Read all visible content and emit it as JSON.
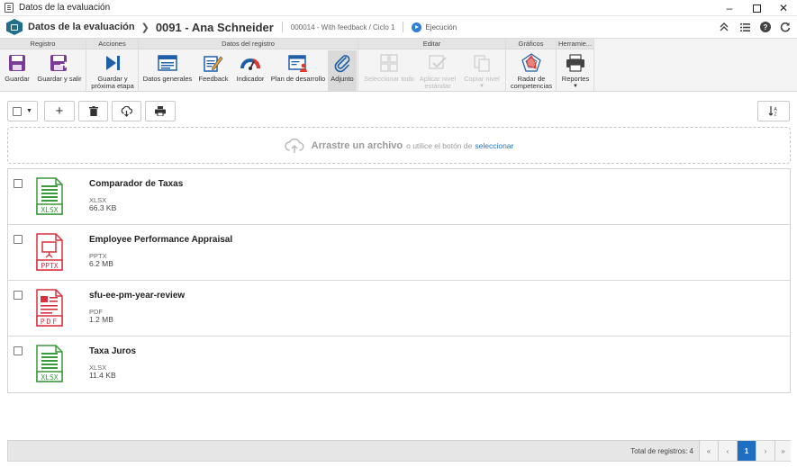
{
  "window": {
    "title": "Datos de la evaluación"
  },
  "header": {
    "section": "Datos de la evaluación",
    "record_title": "0091 - Ana Schneider",
    "subtitle": "000014 - With feedback / Ciclo 1",
    "status": "Ejecución"
  },
  "ribbon": {
    "groups": [
      {
        "title": "Registro"
      },
      {
        "title": "Acciones"
      },
      {
        "title": "Datos del registro"
      },
      {
        "title": "Editar"
      },
      {
        "title": "Gráficos"
      },
      {
        "title": "Herramie..."
      }
    ],
    "buttons": {
      "save": "Guardar",
      "save_exit": "Guardar y salir",
      "save_next_1": "Guardar y",
      "save_next_2": "próxima etapa",
      "general": "Datos generales",
      "feedback": "Feedback",
      "indicator": "Indicador",
      "dev_plan": "Plan de desarrollo",
      "attachment": "Adjunto",
      "select_all": "Seleccionar todo",
      "apply_level_1": "Aplicar nivel",
      "apply_level_2": "estándar",
      "copy_level": "Copiar nivel",
      "radar_1": "Radar de",
      "radar_2": "competencias",
      "reports": "Reportes"
    }
  },
  "dropzone": {
    "strong": "Arrastre un archivo",
    "text": "o utilice el botón de",
    "link": "seleccionar"
  },
  "files": [
    {
      "name": "Comparador de Taxas",
      "type": "XLSX",
      "size": "66.3 KB",
      "icon": "xlsx-file-icon",
      "color": "#3a9a3a"
    },
    {
      "name": "Employee Performance Appraisal",
      "type": "PPTX",
      "size": "6.2 MB",
      "icon": "pptx-file-icon",
      "color": "#d9303e"
    },
    {
      "name": "sfu-ee-pm-year-review",
      "type": "PDF",
      "size": "1.2 MB",
      "icon": "pdf-file-icon",
      "color": "#d9303e"
    },
    {
      "name": "Taxa Juros",
      "type": "XLSX",
      "size": "11.4 KB",
      "icon": "xlsx-file-icon",
      "color": "#3a9a3a"
    }
  ],
  "footer": {
    "total": "Total de registros: 4",
    "first": "«",
    "prev": "‹",
    "page": "1",
    "next": "›",
    "last": "»"
  }
}
